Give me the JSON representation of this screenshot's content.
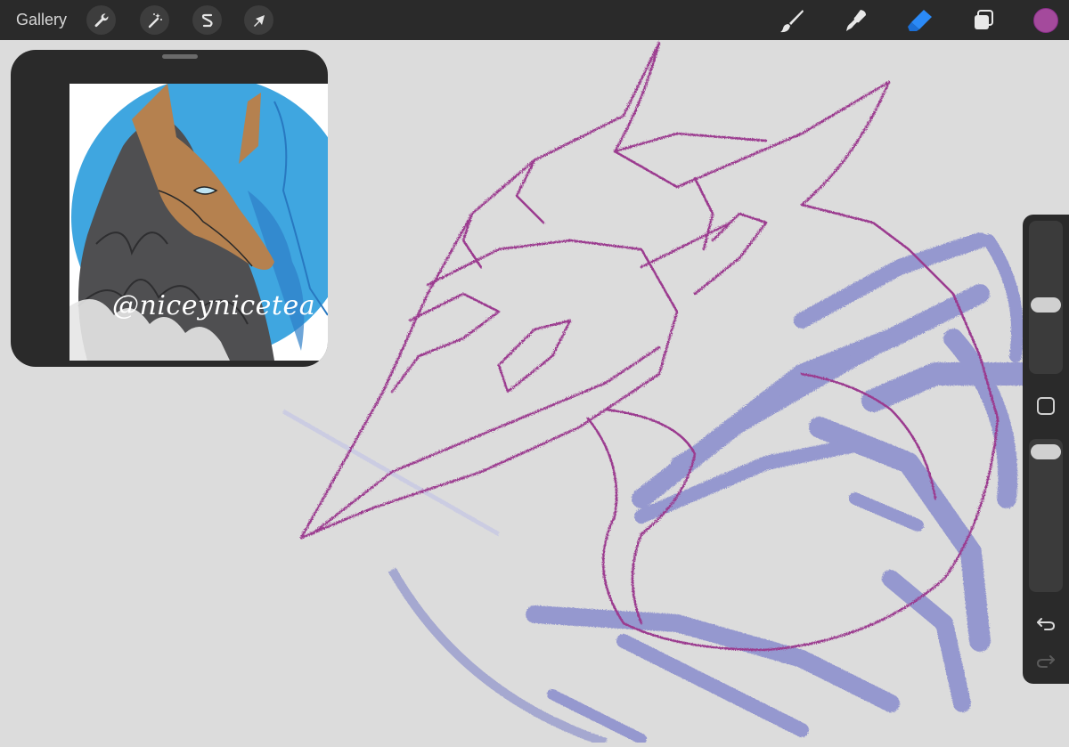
{
  "topbar": {
    "gallery_label": "Gallery",
    "left_tools": [
      {
        "name": "actions",
        "icon": "wrench-icon"
      },
      {
        "name": "adjustments",
        "icon": "magic-wand-icon"
      },
      {
        "name": "selection",
        "icon": "selection-s-icon"
      },
      {
        "name": "transform",
        "icon": "arrow-cursor-icon"
      }
    ],
    "right_tools": [
      {
        "name": "brush",
        "icon": "brush-icon"
      },
      {
        "name": "smudge",
        "icon": "smudge-icon"
      },
      {
        "name": "eraser",
        "icon": "eraser-icon",
        "active": true
      },
      {
        "name": "layers",
        "icon": "layers-icon"
      }
    ],
    "current_color": "#a44a9c",
    "accent_color": "#2b8af7"
  },
  "reference": {
    "watermark": "@niceynicetea"
  },
  "sidebar": {
    "brush_size_icon": "size-slider",
    "opacity_icon": "opacity-slider",
    "modifier_icon": "square-modifier-icon",
    "undo_icon": "undo-icon",
    "redo_icon": "redo-icon"
  },
  "canvas": {
    "sketch_color_magenta": "#9b3a8f",
    "sketch_color_blue": "#8f93cc"
  }
}
